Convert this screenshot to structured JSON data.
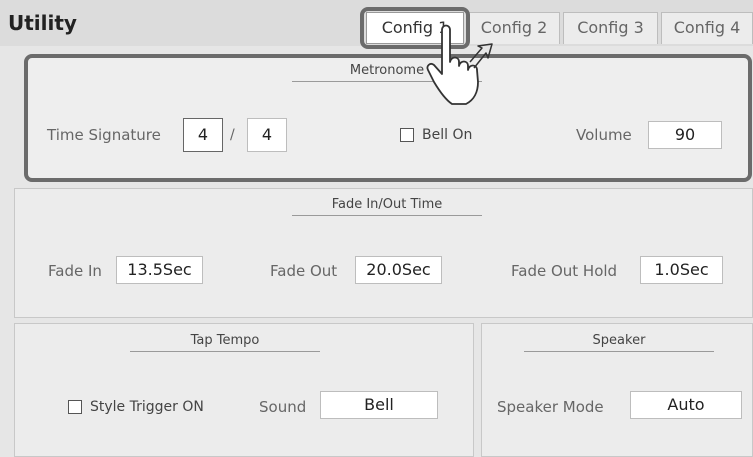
{
  "app_title": "Utility",
  "tabs": [
    {
      "label": "Config 1",
      "active": true
    },
    {
      "label": "Config 2",
      "active": false
    },
    {
      "label": "Config 3",
      "active": false
    },
    {
      "label": "Config 4",
      "active": false
    }
  ],
  "metronome": {
    "title": "Metronome",
    "time_signature_label": "Time Signature",
    "numerator": "4",
    "separator": "/",
    "denominator": "4",
    "bell_label": "Bell On",
    "bell_checked": false,
    "volume_label": "Volume",
    "volume_value": "90"
  },
  "fade": {
    "title": "Fade In/Out Time",
    "fade_in_label": "Fade In",
    "fade_in_value": "13.5Sec",
    "fade_out_label": "Fade Out",
    "fade_out_value": "20.0Sec",
    "hold_label": "Fade Out Hold",
    "hold_value": "1.0Sec"
  },
  "tap_tempo": {
    "title": "Tap Tempo",
    "trigger_label": "Style Trigger ON",
    "trigger_checked": false,
    "sound_label": "Sound",
    "sound_value": "Bell"
  },
  "speaker": {
    "title": "Speaker",
    "mode_label": "Speaker Mode",
    "mode_value": "Auto"
  },
  "colors": {
    "background": "#e6e6e6",
    "highlight_border": "#6b6b6b",
    "field_bg": "#ffffff"
  },
  "overlay": {
    "icon": "hand-pointer-icon"
  }
}
